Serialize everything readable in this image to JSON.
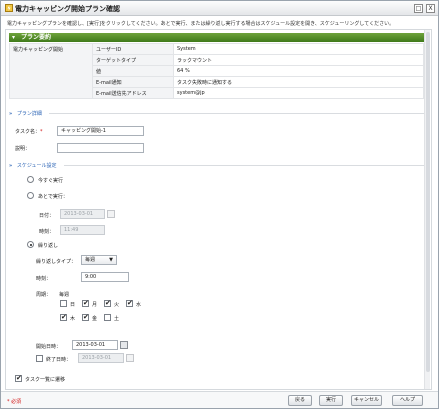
{
  "window": {
    "title": "電力キャッピング開始プラン確認",
    "restore_glyph": "□",
    "close_glyph": "X"
  },
  "description": "電力キャッピングプランを確認し、[実行]をクリックしてください。あとで実行、または繰り返し実行する場合はスケジュール設定を開き、スケジューリングしてください。",
  "plan_summary": {
    "header": "プラン要約",
    "section_label": "電力キャッピング開始",
    "rows": [
      {
        "key": "ユーザーID",
        "value": "System"
      },
      {
        "key": "ターゲットタイプ",
        "value": "ラックマウント"
      },
      {
        "key": "値",
        "value": "64 %"
      },
      {
        "key": "E-mail通知",
        "value": "タスク失敗時に通知する"
      },
      {
        "key": "E-mail送信先アドレス",
        "value": "system@jp"
      }
    ]
  },
  "plan_details": {
    "header": "プラン詳細",
    "task_name_label": "タスク名：",
    "required_mark": "*",
    "task_name_value": "キャッピング開始-1",
    "description_label": "説明：",
    "description_value": ""
  },
  "schedule": {
    "header": "スケジュール設定",
    "run_now_label": "今すぐ実行",
    "run_later_label": "あとで実行：",
    "later_date_label": "日付：",
    "later_date_value": "2013-03-01",
    "later_time_label": "時刻：",
    "later_time_value": "11:49",
    "repeat_label": "繰り返し",
    "repeat_type_label": "繰り返しタイプ：",
    "repeat_type_value": "毎週",
    "repeat_time_label": "時刻：",
    "repeat_time_value": "9:00",
    "period_label": "周期：",
    "period_value": "毎週",
    "days": [
      {
        "label": "日",
        "checked": false
      },
      {
        "label": "月",
        "checked": true
      },
      {
        "label": "火",
        "checked": true
      },
      {
        "label": "水",
        "checked": true
      },
      {
        "label": "木",
        "checked": true
      },
      {
        "label": "金",
        "checked": true
      },
      {
        "label": "土",
        "checked": false
      }
    ],
    "start_date_label": "開始日時：",
    "start_date_value": "2013-03-01",
    "end_date_label": "終了日時：",
    "end_date_value": "2013-03-01"
  },
  "show_task_list_label": "タスク一覧に遷移",
  "footer": {
    "required_note": "* 必須",
    "back_label": "戻る",
    "run_label": "実行",
    "cancel_label": "キャンセル",
    "help_label": "ヘルプ"
  },
  "colors": {
    "header_green": "#4f8a26",
    "link_blue": "#2a63b5",
    "required_red": "#d01010"
  },
  "check_glyph": "✔"
}
